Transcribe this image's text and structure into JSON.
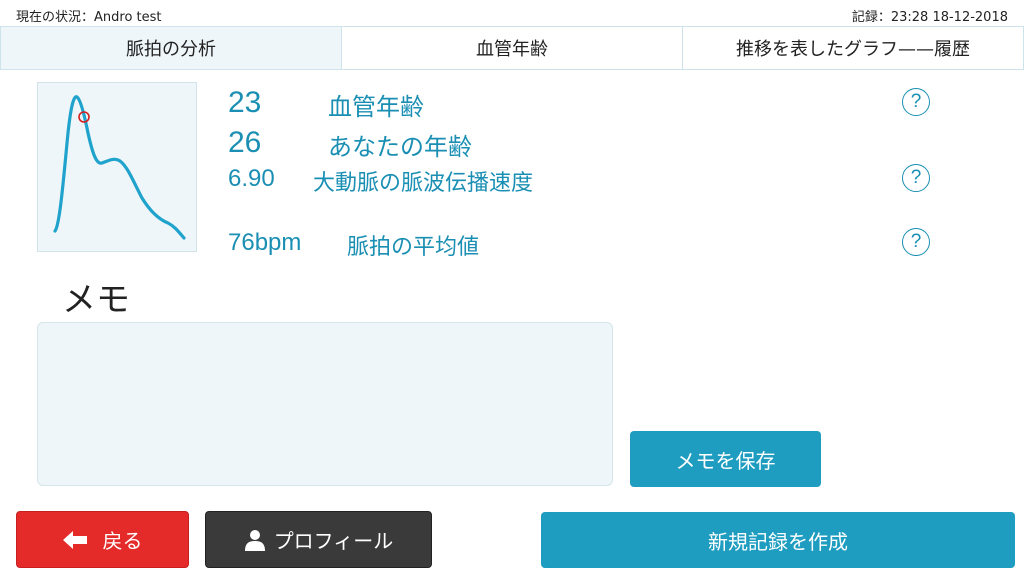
{
  "status_bar": {
    "left": "現在の状況：Andro test",
    "right": "記録：23:28 18-12-2018"
  },
  "tabs": [
    {
      "label": "脈拍の分析",
      "active": true
    },
    {
      "label": "血管年齢",
      "active": false
    },
    {
      "label": "推移を表したグラフ——履歴",
      "active": false
    }
  ],
  "metrics": {
    "vascular_age_value": "23",
    "vascular_age_label": "血管年齢",
    "your_age_value": "26",
    "your_age_label": "あなたの年齢",
    "pwv_value": "6.90",
    "pwv_label": "大動脈の脈波伝播速度",
    "pulse_value": "76bpm",
    "pulse_label": "脈拍の平均値"
  },
  "help_icon_glyph": "?",
  "memo": {
    "title": "メモ",
    "value": "",
    "placeholder": ""
  },
  "buttons": {
    "save_memo": "メモを保存",
    "back": "戻る",
    "profile": "プロフィール",
    "new_record": "新規記録を作成"
  },
  "icons": {
    "back": "arrow-left-icon",
    "profile": "user-icon",
    "help": "question-circle-icon"
  },
  "colors": {
    "accent": "#1f9dc0",
    "text_accent": "#1a8fb3",
    "back_button": "#e52a2a",
    "profile_button": "#3a3a3a",
    "panel_bg": "#eef6f9",
    "marker": "#d42020"
  }
}
